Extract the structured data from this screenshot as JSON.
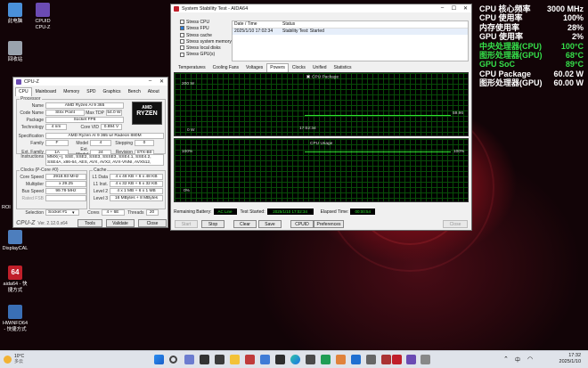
{
  "desktop": {
    "icons": [
      {
        "label": "此电脑",
        "color": "#4a90d9"
      },
      {
        "label": "CPUID CPU-Z",
        "color": "#6b4bb3"
      },
      {
        "label": "回收站",
        "color": "#9aa3ad"
      },
      {
        "label": "DisplayCAL",
        "color": "#4d7ebd"
      },
      {
        "label": "aida64 - 快捷方式",
        "color": "#c01f2a"
      },
      {
        "label": "HWiNFO64 - 快捷方式",
        "color": "#3a6fb5"
      }
    ],
    "partial_icon_label": "ROI"
  },
  "overlay": {
    "rows": [
      {
        "k": "CPU 核心频率",
        "v": "3000 MHz",
        "c": "#ffffff"
      },
      {
        "k": "CPU 使用率",
        "v": "100%",
        "c": "#ffffff"
      },
      {
        "k": "内存使用率",
        "v": "28%",
        "c": "#ffffff"
      },
      {
        "k": "GPU 使用率",
        "v": "2%",
        "c": "#ffffff"
      },
      {
        "k": "中央处理器(CPU)",
        "v": "100°C",
        "c": "#35e04a"
      },
      {
        "k": "图形处理器(GPU)",
        "v": "68°C",
        "c": "#35e04a"
      },
      {
        "k": "GPU SoC",
        "v": "89°C",
        "c": "#35e04a"
      },
      {
        "k": "CPU Package",
        "v": "60.02 W",
        "c": "#ffffff"
      },
      {
        "k": "图形处理器(GPU)",
        "v": "60.00 W",
        "c": "#ffffff"
      }
    ]
  },
  "cpuz": {
    "title": "CPU-Z",
    "tabs": [
      "CPU",
      "Mainboard",
      "Memory",
      "SPD",
      "Graphics",
      "Bench",
      "About"
    ],
    "processor_label": "Processor",
    "name_label": "Name",
    "name": "AMD Ryzen AI 9 365",
    "codename_label": "Code Name",
    "codename": "Strix Point",
    "maxtdp_label": "Max TDP",
    "maxtdp": "54.0 W",
    "package_label": "Package",
    "package": "Socket FP8",
    "tech_label": "Technology",
    "tech": "4 nm",
    "corevid_label": "Core VID",
    "corevid": "0.894 V",
    "spec_label": "Specification",
    "spec": "AMD Ryzen AI 9 365 w/ Radeon 880M",
    "family_label": "Family",
    "family": "F",
    "model_label": "Model",
    "model": "4",
    "stepping_label": "Stepping",
    "stepping": "0",
    "extfam_label": "Ext. Family",
    "extfam": "1A",
    "extmodel_label": "Ext. Model",
    "extmodel": "24",
    "revision_label": "Revision",
    "revision": "STX-B0",
    "instr_label": "Instructions",
    "instr": "MMX(+), SSE, SSE2, SSE3, SSSE3, SSE4.1, SSE4.2, SSE4A, x86-64, AES, AVX, AVX2, AVX-VNNI, AVX512, FMA3, SHA",
    "clocks_label": "Clocks (P-Core #0)",
    "corespeed_label": "Core Speed",
    "corespeed": "2918.93 MHz",
    "mult_label": "Multiplier",
    "mult": "x 29.25",
    "bus_label": "Bus Speed",
    "bus": "99.79 MHz",
    "ratedfsb_label": "Rated FSB",
    "ratedfsb": "",
    "cache_label": "Cache",
    "l1d_label": "L1 Data",
    "l1d": "4 x 48 KB + 6 x 48 KB",
    "l1i_label": "L1 Inst.",
    "l1i": "4 x 32 KB + 6 x 32 KB",
    "l2_label": "Level 2",
    "l2": "4 x 1 MB + 6 x 1 MB",
    "l3_label": "Level 3",
    "l3": "16 MBytes + 8 MBytes",
    "sel_label": "Selection",
    "sel": "Socket #1",
    "cores_label": "Cores",
    "cores": "4 + 6E",
    "threads_label": "Threads",
    "threads": "20",
    "footer_logo": "CPU-Z",
    "version": "Ver. 2.12.0.x64",
    "tools": "Tools",
    "validate": "Validate",
    "close": "Close",
    "logo_brand": "AMD",
    "logo_line": "RYZEN"
  },
  "sst": {
    "title": "System Stability Test - AIDA64",
    "checks": [
      {
        "label": "Stress CPU",
        "checked": false
      },
      {
        "label": "Stress FPU",
        "checked": true
      },
      {
        "label": "Stress cache",
        "checked": false
      },
      {
        "label": "Stress system memory",
        "checked": false
      },
      {
        "label": "Stress local disks",
        "checked": false
      },
      {
        "label": "Stress GPU(s)",
        "checked": false
      }
    ],
    "col_date": "Date / Time",
    "col_status": "Status",
    "log_date": "2025/1/10 17:02:34",
    "log_status": "Stability Test: Started",
    "tabs": [
      "Temperatures",
      "Cooling Fans",
      "Voltages",
      "Powers",
      "Clocks",
      "Unified",
      "Statistics"
    ],
    "active_tab": "Powers",
    "graph1": {
      "title": "CPU Package",
      "ymax": "200 W",
      "ymin": "0 W",
      "time": "17:02:34",
      "value": "59.96"
    },
    "graph2": {
      "title": "CPU Usage",
      "ymax": "100%",
      "ymin": "0%",
      "value_right": "100%"
    },
    "battery_label": "Remaining Battery:",
    "battery": "AC Line",
    "started_label": "Test Started:",
    "started": "2025/1/10 17:02:34",
    "elapsed_label": "Elapsed Time:",
    "elapsed": "00:00:54",
    "buttons": {
      "start": "Start",
      "stop": "Stop",
      "clear": "Clear",
      "save": "Save",
      "cpuid": "CPUID",
      "prefs": "Preferences",
      "close": "Close"
    }
  },
  "taskbar": {
    "weather_temp": "10°C",
    "weather_desc": "多云",
    "time": "17:32",
    "date": "2025/1/10",
    "lang": "中"
  }
}
